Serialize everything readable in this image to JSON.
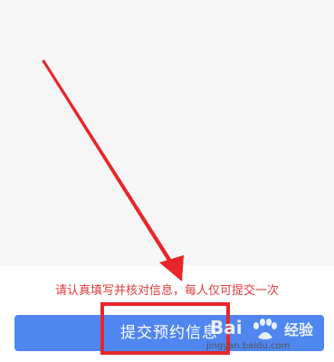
{
  "notice_text": "请认真填写并核对信息，每人仅可提交一次",
  "submit_button_label": "提交预约信息",
  "watermark": {
    "brand": "Bai",
    "brand_suffix": "经验",
    "url": "jingyan.baidu.com"
  },
  "colors": {
    "primary": "#4f86f0",
    "annotation_red": "#e8262a",
    "notice_red": "#e23a3a",
    "content_bg": "#f6f6f6"
  }
}
